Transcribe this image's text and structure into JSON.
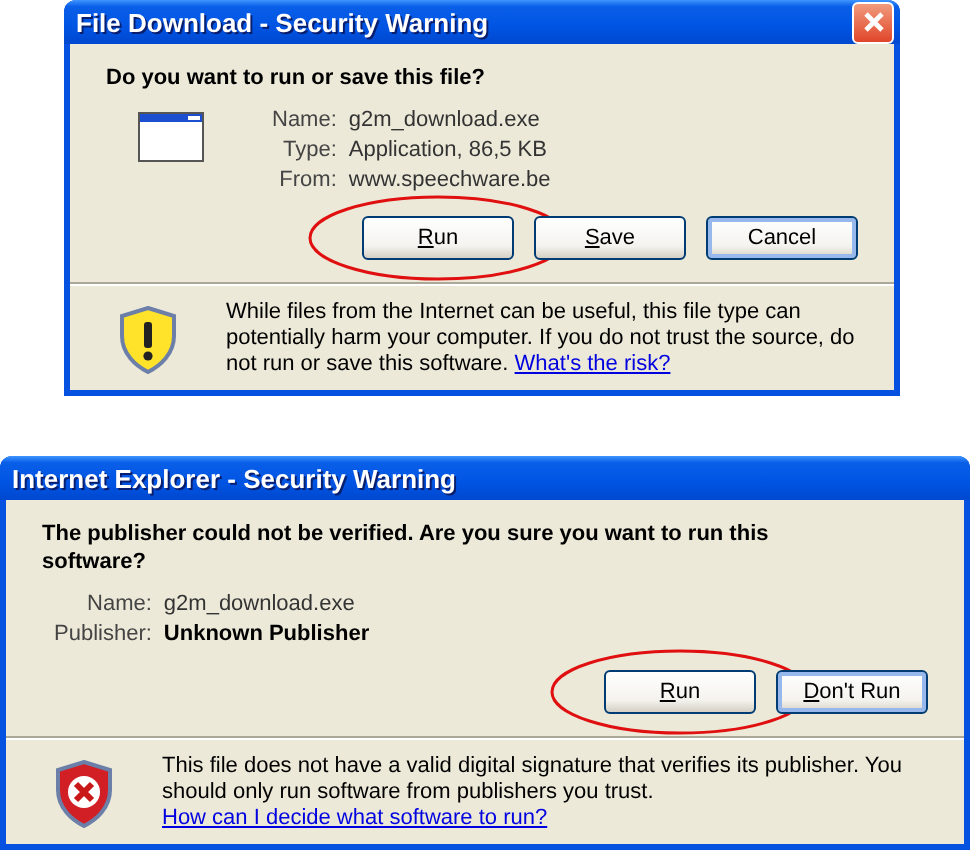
{
  "dialogs": [
    {
      "title": "File Download - Security Warning",
      "close_button": true,
      "question": "Do you want to run or save this file?",
      "file_icon": true,
      "fields": [
        {
          "label": "Name:",
          "value": "g2m_download.exe",
          "bold": false
        },
        {
          "label": "Type:",
          "value": "Application, 86,5 KB",
          "bold": false
        },
        {
          "label": "From:",
          "value": "www.speechware.be",
          "bold": false
        }
      ],
      "buttons": [
        {
          "label": "Run",
          "mnemonic": true,
          "default": false,
          "highlighted": true
        },
        {
          "label": "Save",
          "mnemonic": true,
          "default": false,
          "highlighted": false
        },
        {
          "label": "Cancel",
          "mnemonic": false,
          "default": true,
          "highlighted": false
        }
      ],
      "warning": {
        "kind": "caution",
        "text": "While files from the Internet can be useful, this file type can potentially harm your computer. If you do not trust the source, do not run or save this software.",
        "link": "What's the risk?"
      }
    },
    {
      "title": "Internet Explorer - Security Warning",
      "question": "The publisher could not be verified.  Are you sure you want to run this software?",
      "fields": [
        {
          "label": "Name:",
          "value": "g2m_download.exe",
          "bold": false
        },
        {
          "label": "Publisher:",
          "value": "Unknown Publisher",
          "bold": true
        }
      ],
      "buttons": [
        {
          "label": "Run",
          "mnemonic": true,
          "default": false,
          "highlighted": true
        },
        {
          "label": "Don't Run",
          "mnemonic": true,
          "default": true,
          "highlighted": false
        }
      ],
      "warning": {
        "kind": "error",
        "text": "This file does not have a valid digital signature that verifies its publisher. You should only run software from publishers you trust.",
        "link": "How can I decide what software to run?"
      }
    }
  ]
}
